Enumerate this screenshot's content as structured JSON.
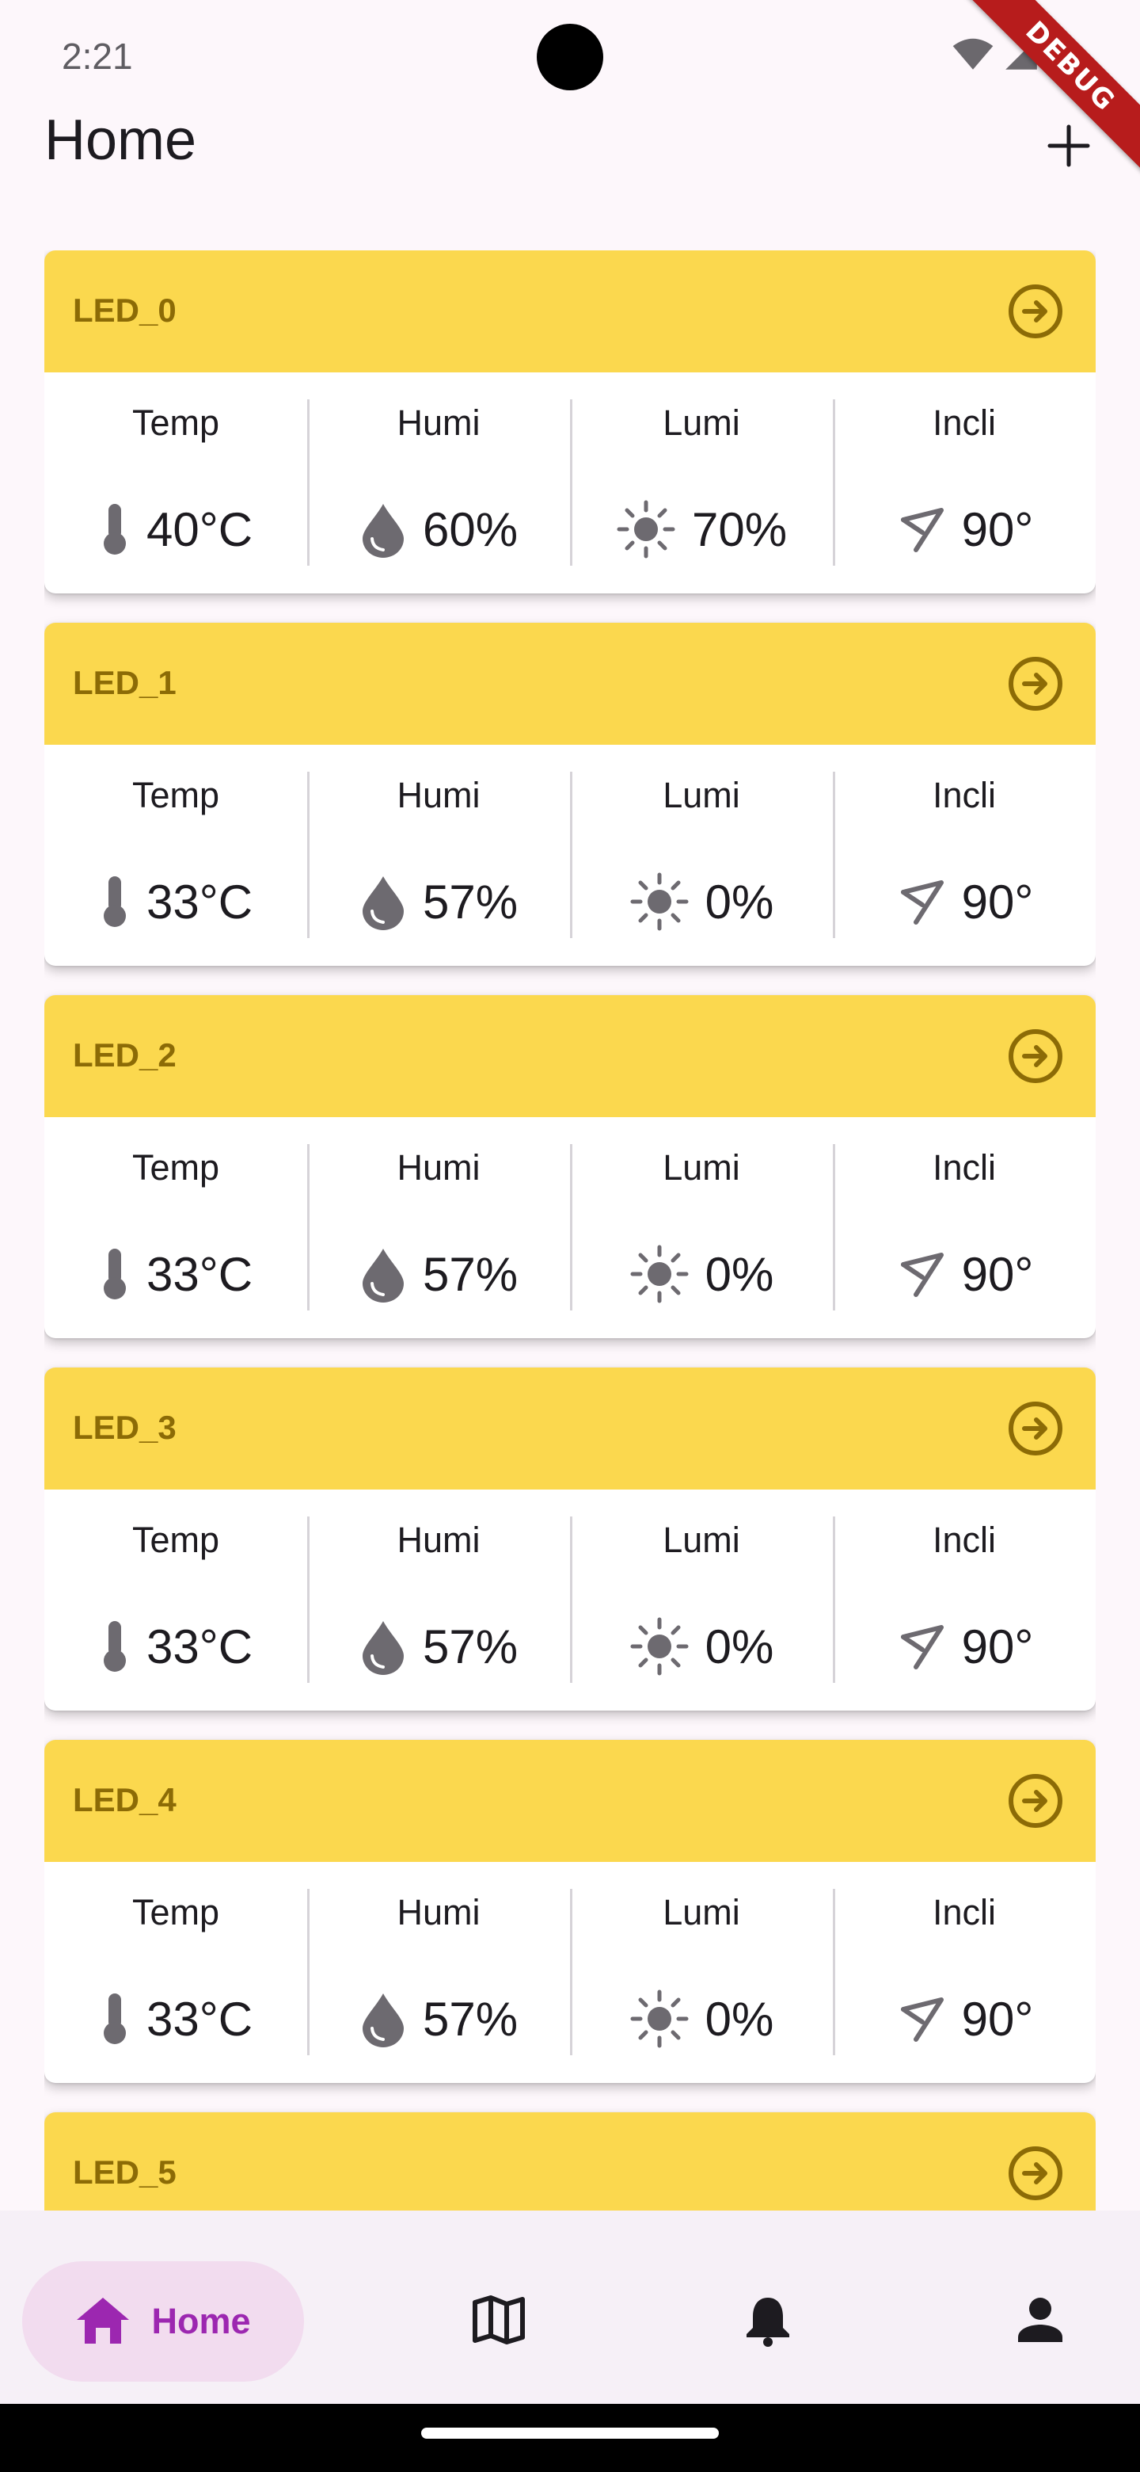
{
  "status_bar": {
    "time": "2:21"
  },
  "debug_banner": "DEBUG",
  "app_bar": {
    "title": "Home",
    "add_icon": "plus-icon"
  },
  "labels": {
    "temp": "Temp",
    "humi": "Humi",
    "lumi": "Lumi",
    "incli": "Incli"
  },
  "devices": [
    {
      "name": "LED_0",
      "temp": "40°C",
      "humi": "60%",
      "lumi": "70%",
      "incli": "90°"
    },
    {
      "name": "LED_1",
      "temp": "33°C",
      "humi": "57%",
      "lumi": "0%",
      "incli": "90°"
    },
    {
      "name": "LED_2",
      "temp": "33°C",
      "humi": "57%",
      "lumi": "0%",
      "incli": "90°"
    },
    {
      "name": "LED_3",
      "temp": "33°C",
      "humi": "57%",
      "lumi": "0%",
      "incli": "90°"
    },
    {
      "name": "LED_4",
      "temp": "33°C",
      "humi": "57%",
      "lumi": "0%",
      "incli": "90°"
    },
    {
      "name": "LED_5"
    }
  ],
  "bottom_nav": {
    "items": [
      {
        "label": "Home",
        "icon": "home-icon",
        "selected": true
      },
      {
        "icon": "map-icon"
      },
      {
        "icon": "bell-icon"
      },
      {
        "icon": "person-icon"
      }
    ]
  },
  "colors": {
    "card_header": "#fbd84e",
    "card_title": "#8c6b06",
    "accent": "#9c27b0",
    "nav_active_bg": "#f2dcef",
    "icon_grey": "#5f6368",
    "background": "#fdf7fb"
  }
}
